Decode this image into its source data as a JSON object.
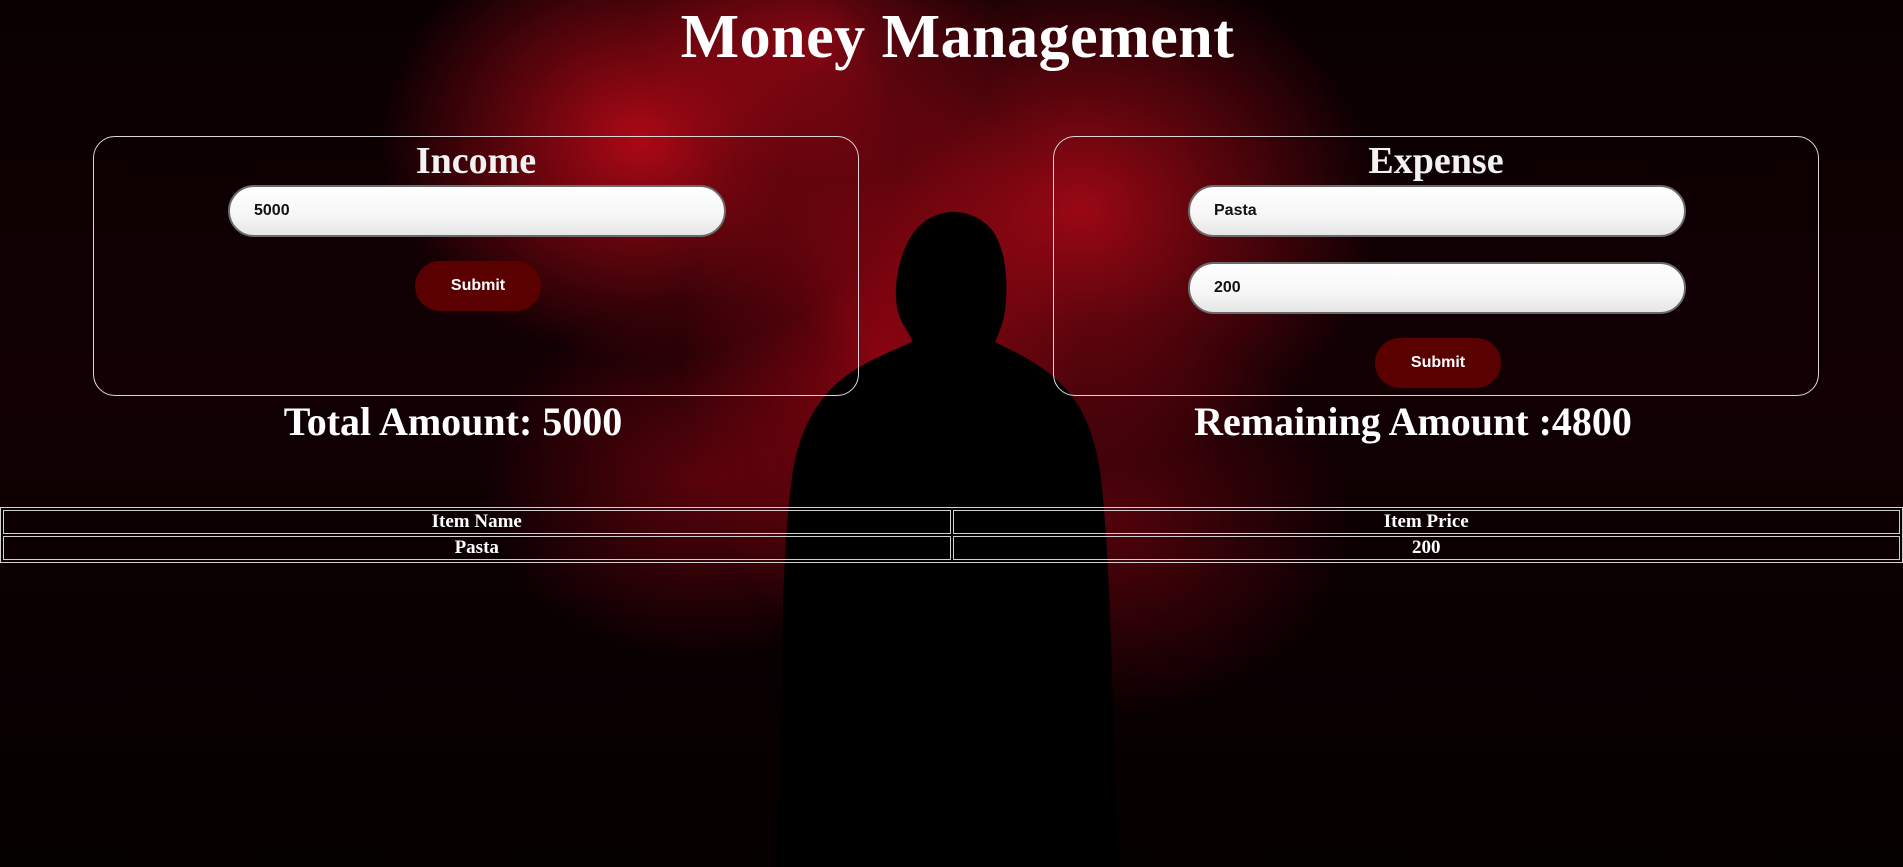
{
  "page": {
    "title": "Money Management"
  },
  "income": {
    "title": "Income",
    "amount_value": "5000",
    "submit_label": "Submit"
  },
  "expense": {
    "title": "Expense",
    "item_name_value": "Pasta",
    "item_price_value": "200",
    "submit_label": "Submit"
  },
  "summary": {
    "total_text": "Total Amount: 5000",
    "remaining_text": "Remaining Amount :4800"
  },
  "table": {
    "headers": [
      "Item Name",
      "Item Price"
    ],
    "rows": [
      [
        "Pasta",
        "200"
      ]
    ]
  },
  "colors": {
    "accent_button": "#5a0000",
    "background": "#050000",
    "smoke_red": "#c80a19"
  }
}
